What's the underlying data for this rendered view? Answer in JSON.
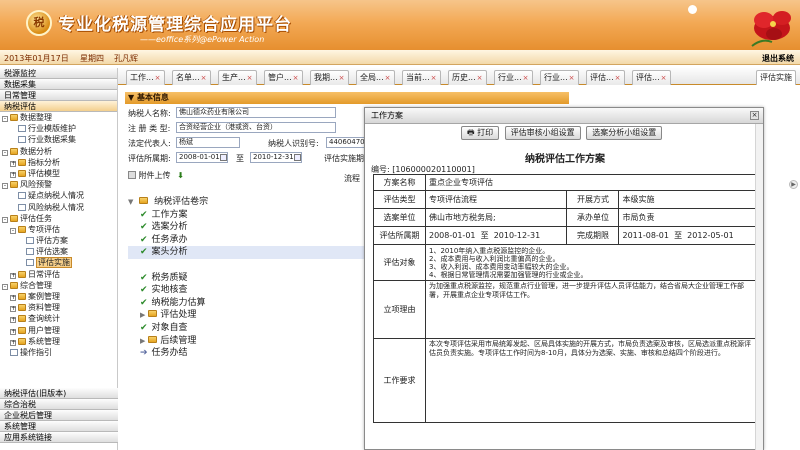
{
  "header": {
    "logo_text": "税",
    "title": "专业化税源管理综合应用平台",
    "subtitle": "——eoffice系列@ePower Action"
  },
  "statusbar": {
    "date": "2013年01月17日",
    "weekday": "星期四",
    "user": "孔凡辉",
    "logout": "退出系统"
  },
  "leftnav": {
    "sections_top": [
      "税源监控",
      "数据采集",
      "日常管理",
      "纳税评估"
    ],
    "tree": [
      {
        "label": "数据整理",
        "indent": 1,
        "type": "folder",
        "mark": "-"
      },
      {
        "label": "行业模版维护",
        "indent": 2,
        "type": "doc"
      },
      {
        "label": "行业数据采集",
        "indent": 2,
        "type": "doc"
      },
      {
        "label": "数据分析",
        "indent": 1,
        "type": "folder",
        "mark": "-"
      },
      {
        "label": "指标分析",
        "indent": 2,
        "type": "folder",
        "mark": "+"
      },
      {
        "label": "评估模型",
        "indent": 2,
        "type": "folder",
        "mark": "+"
      },
      {
        "label": "风险预警",
        "indent": 1,
        "type": "folder",
        "mark": "-"
      },
      {
        "label": "疑点纳税人情况",
        "indent": 2,
        "type": "doc"
      },
      {
        "label": "风险纳税人情况",
        "indent": 2,
        "type": "doc"
      },
      {
        "label": "评估任务",
        "indent": 1,
        "type": "folder",
        "mark": "-"
      },
      {
        "label": "专项评估",
        "indent": 2,
        "type": "folder",
        "mark": "-"
      },
      {
        "label": "评估方案",
        "indent": 3,
        "type": "doc"
      },
      {
        "label": "评估选案",
        "indent": 3,
        "type": "doc"
      },
      {
        "label": "评估实施",
        "indent": 3,
        "type": "doc",
        "selected": true
      },
      {
        "label": "日常评估",
        "indent": 2,
        "type": "folder",
        "mark": "+"
      },
      {
        "label": "综合管理",
        "indent": 1,
        "type": "folder",
        "mark": "-"
      },
      {
        "label": "案例管理",
        "indent": 2,
        "type": "folder",
        "mark": "+"
      },
      {
        "label": "资料管理",
        "indent": 2,
        "type": "folder",
        "mark": "+"
      },
      {
        "label": "查询统计",
        "indent": 2,
        "type": "folder",
        "mark": "+"
      },
      {
        "label": "用户管理",
        "indent": 2,
        "type": "folder",
        "mark": "+"
      },
      {
        "label": "系统管理",
        "indent": 2,
        "type": "folder",
        "mark": "+"
      },
      {
        "label": "操作指引",
        "indent": 1,
        "type": "doc"
      }
    ],
    "sections_bottom": [
      "纳税评估(旧版本)",
      "综合治税",
      "企业税后管理",
      "系统管理",
      "应用系统链接"
    ]
  },
  "tabs": [
    {
      "label": "工作..."
    },
    {
      "label": "名单..."
    },
    {
      "label": "生产..."
    },
    {
      "label": "管户..."
    },
    {
      "label": "我期..."
    },
    {
      "label": "全局..."
    },
    {
      "label": "当前..."
    },
    {
      "label": "历史..."
    },
    {
      "label": "行业..."
    },
    {
      "label": "行业..."
    },
    {
      "label": "评估..."
    },
    {
      "label": "评估..."
    },
    {
      "label": "评估实施",
      "active": true
    }
  ],
  "basic": {
    "section_title": "▼ 基本信息",
    "taxpayer_name_label": "纳税人名称:",
    "taxpayer_name": "佛山德众药业有限公司",
    "reg_type_label": "注 册 类 型:",
    "reg_type": "合资经营企业（港或资、台资）",
    "legal_rep_label": "法定代表人:",
    "legal_rep": "杨斌",
    "taxpayer_id_label": "纳税人识别号:",
    "taxpayer_id": "440604707955",
    "period_label": "评估所属期:",
    "period_from": "2008-01-01",
    "to": "至",
    "period_to": "2010-12-31",
    "impl_period_label": "评估实施期:",
    "process_label": "流程"
  },
  "actions": {
    "upload": "附件上传"
  },
  "process_tree": {
    "root": "纳税评估卷宗",
    "items": [
      {
        "label": "工作方案",
        "type": "check"
      },
      {
        "label": "选案分析",
        "type": "check"
      },
      {
        "label": "任务承办",
        "type": "check"
      },
      {
        "label": "案头分析",
        "type": "check",
        "selected": true
      },
      {
        "label": "",
        "type": "gap"
      },
      {
        "label": "税务质疑",
        "type": "check"
      },
      {
        "label": "实地核查",
        "type": "check"
      },
      {
        "label": "纳税能力估算",
        "type": "check"
      },
      {
        "label": "评估处理",
        "type": "folder"
      },
      {
        "label": "对象自查",
        "type": "check"
      },
      {
        "label": "后续管理",
        "type": "folder"
      },
      {
        "label": "任务办结",
        "type": "arrow"
      }
    ]
  },
  "dialog": {
    "title": "工作方案",
    "buttons": [
      "打印",
      "评估审核小组设置",
      "选案分析小组设置"
    ],
    "doc_title": "纳税评估工作方案",
    "doc_no": "编号: [106000020110001]",
    "rows": {
      "plan_name_label": "方案名称",
      "plan_name": "重点企业专项评估",
      "eval_type_label": "评估类型",
      "eval_type": "专项评估流程",
      "mode_label": "开展方式",
      "mode": "本级实施",
      "unit_label": "选案单位",
      "unit": "佛山市地方税务局;",
      "undertake_label": "承办单位",
      "undertake": "市局负责",
      "period_label": "评估所属期",
      "period_from": "2008-01-01",
      "to": "至",
      "period_to": "2010-12-31",
      "deadline_label": "完成期限",
      "deadline_from": "2011-08-01",
      "deadline_to": "2012-05-01",
      "object_label": "评估对象",
      "object_lines": [
        "1、2010年纳入重点税源监控的企业。",
        "2、成本费用与收入利润比重偏高的企业。",
        "3、收入利润、成本费用变动率幅较大的企业。",
        "4、根据日常管理情况需要加强管理的行业或企业。"
      ],
      "reason_label": "立项理由",
      "reason": "为加强重点税源监控，规范重点行业管理，进一步提升评估人员评估能力，结合省局大企业管理工作部署，开展重点企业专项评估工作。",
      "req_label": "工作要求",
      "req": "本次专项评估采用市局统筹发起、区局具体实施的开展方式，市局负责选案及审核，区局选派重点税源评估员负责实施。专项评估工作时间为8-10月，具体分为选案、实施、审核和总结四个阶段进行。"
    }
  }
}
